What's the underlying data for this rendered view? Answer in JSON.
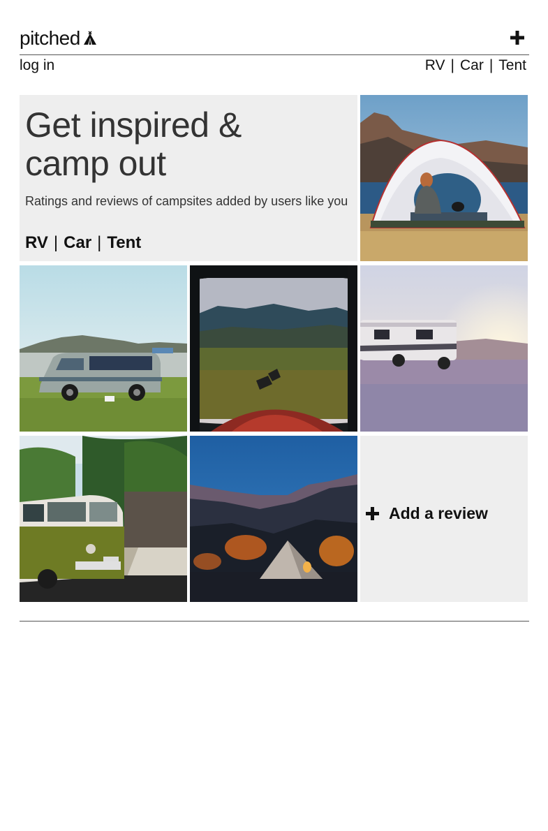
{
  "header": {
    "logo_text": "pitched",
    "logo_icon": "tent-icon",
    "add_icon": "plus-icon"
  },
  "nav": {
    "login_label": "log in",
    "types": [
      "RV",
      "Car",
      "Tent"
    ],
    "separator": "|"
  },
  "hero": {
    "title_line1": "Get inspired &",
    "title_line2": "camp out",
    "subtitle": "Ratings and reviews of campsites added by users like you",
    "types": [
      "RV",
      "Car",
      "Tent"
    ],
    "separator": "|"
  },
  "tiles": [
    {
      "name": "tent by lake",
      "kind": "photo"
    },
    {
      "name": "van on beach",
      "kind": "photo"
    },
    {
      "name": "view from tent hammock",
      "kind": "photo"
    },
    {
      "name": "rv at sunset",
      "kind": "photo"
    },
    {
      "name": "vw bus in jungle",
      "kind": "photo"
    },
    {
      "name": "lit tent in canyon",
      "kind": "photo"
    }
  ],
  "add_review": {
    "label": "Add a review",
    "icon": "plus-icon"
  },
  "colors": {
    "panel_bg": "#eeeeee",
    "text": "#111111",
    "divider": "#555555"
  }
}
